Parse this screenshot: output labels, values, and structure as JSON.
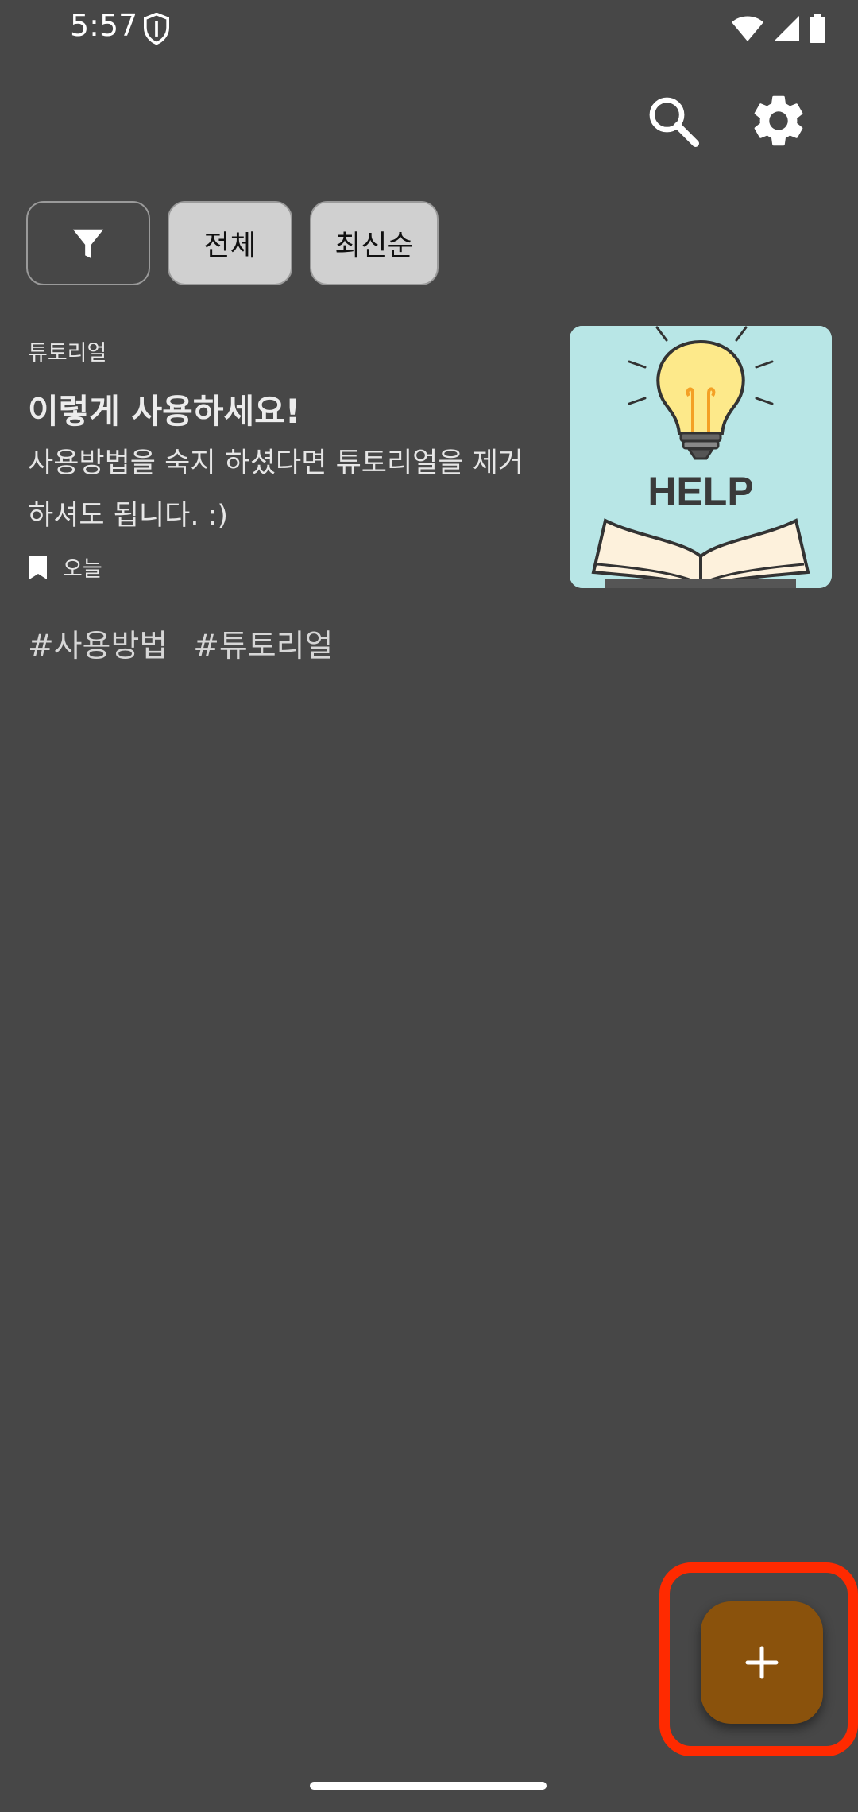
{
  "status_bar": {
    "time": "5:57",
    "icons": [
      "shield-icon",
      "wifi-icon",
      "cellular-icon",
      "battery-icon"
    ]
  },
  "toolbar": {
    "icons": [
      "search-icon",
      "gear-icon"
    ]
  },
  "filters": {
    "filter_icon": "filter-icon",
    "chips": [
      "전체",
      "최신순"
    ]
  },
  "note": {
    "category": "튜토리얼",
    "title": "이렇게 사용하세요!",
    "description": "사용방법을 숙지 하셨다면 튜토리얼을 제거하셔도 됩니다. :)",
    "date": "오늘",
    "thumbnail_text": "HELP"
  },
  "tags": [
    "#사용방법",
    "#튜토리얼"
  ],
  "fab": {
    "icon": "plus-icon"
  },
  "colors": {
    "background": "#474747",
    "chip_bg": "#d0d0d0",
    "fab": "#8a520c",
    "highlight": "#ff2a00",
    "thumbnail_bg": "#b8e6e6"
  }
}
